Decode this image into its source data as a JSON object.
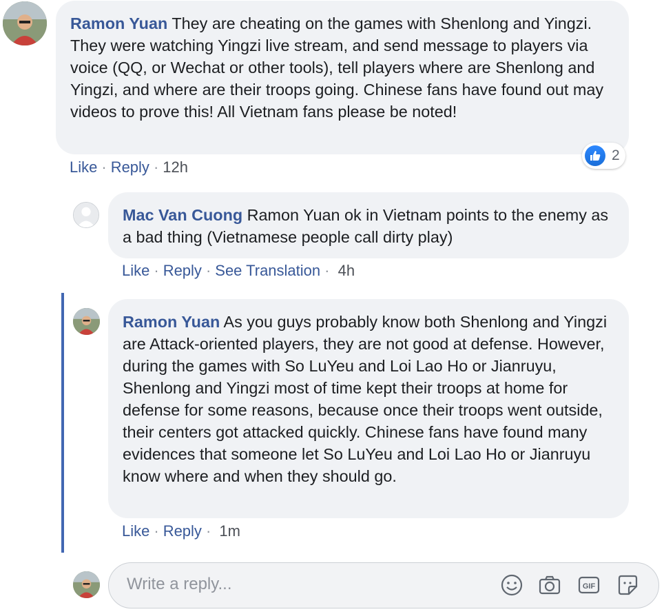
{
  "comment1": {
    "author": "Ramon Yuan",
    "text": "They are cheating on the games with Shenlong and Yingzi. They were watching Yingzi live stream, and send message to players via voice (QQ, or Wechat or other tools), tell players where are Shenlong and Yingzi, and where are their troops going. Chinese fans have found out may videos to prove this! All Vietnam fans please be noted!",
    "like_label": "Like",
    "reply_label": "Reply",
    "time": "12h",
    "reaction_count": "2"
  },
  "reply1": {
    "author": "Mac Van Cuong",
    "text": "Ramon Yuan ok in Vietnam points to the enemy as a bad thing (Vietnamese people call dirty play)",
    "like_label": "Like",
    "reply_label": "Reply",
    "translate_label": "See Translation",
    "time": "4h"
  },
  "reply2": {
    "author": "Ramon Yuan",
    "text": "As you guys probably know both Shenlong and Yingzi are Attack-oriented players, they are not good at defense. However, during the games with So LuYeu and Loi Lao Ho or Jianruyu, Shenlong and Yingzi most of time kept their troops at home for defense for some reasons, because once their troops went outside, their centers got attacked quickly. Chinese fans have found many evidences that someone let So LuYeu and Loi Lao Ho or Jianruyu know where and when they should go.",
    "like_label": "Like",
    "reply_label": "Reply",
    "time": "1m"
  },
  "composer": {
    "placeholder": "Write a reply...",
    "icons": [
      "emoji-icon",
      "camera-icon",
      "gif-icon",
      "sticker-icon"
    ]
  },
  "colors": {
    "author": "#385898",
    "bubble": "#f0f2f5",
    "thread_line": "#4267b2",
    "like_badge": "#2d88ff"
  }
}
